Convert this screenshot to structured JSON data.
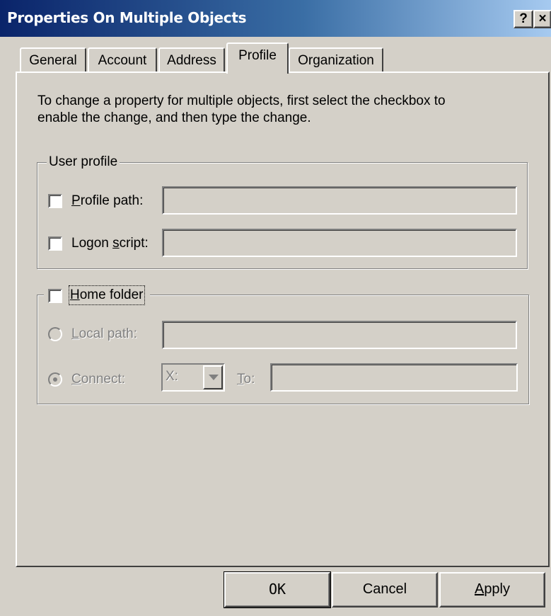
{
  "window": {
    "title": "Properties On Multiple Objects",
    "help_glyph": "?",
    "close_glyph": "×"
  },
  "tabs": [
    {
      "label": "General",
      "active": false
    },
    {
      "label": "Account",
      "active": false
    },
    {
      "label": "Address",
      "active": false
    },
    {
      "label": "Profile",
      "active": true
    },
    {
      "label": "Organization",
      "active": false
    }
  ],
  "instructions": {
    "line1": "To change a property for multiple objects, first select the checkbox to",
    "line2": "enable the change, and then type the change."
  },
  "user_profile": {
    "group_label": "User profile",
    "profile_path": {
      "label_mnemonic": "P",
      "label_rest": "rofile path:",
      "checked": false,
      "value": ""
    },
    "logon_script": {
      "label_pre": "Logon ",
      "label_mnemonic": "s",
      "label_rest": "cript:",
      "checked": false,
      "value": ""
    }
  },
  "home_folder": {
    "label_mnemonic": "H",
    "label_rest": "ome folder",
    "checked": false,
    "local_path": {
      "label_mnemonic": "L",
      "label_rest": "ocal path:",
      "selected": false,
      "value": ""
    },
    "connect": {
      "label_mnemonic": "C",
      "label_rest": "onnect:",
      "selected": true
    },
    "drive": {
      "value": "X:"
    },
    "to": {
      "label_mnemonic": "T",
      "label_rest": "o:",
      "value": ""
    }
  },
  "buttons": {
    "ok": "OK",
    "cancel": "Cancel",
    "apply_mnemonic": "A",
    "apply_rest": "pply"
  },
  "colors": {
    "face": "#d4d0c8",
    "title_start": "#0a246a",
    "title_end": "#a6caf0",
    "disabled_text": "#808080"
  }
}
